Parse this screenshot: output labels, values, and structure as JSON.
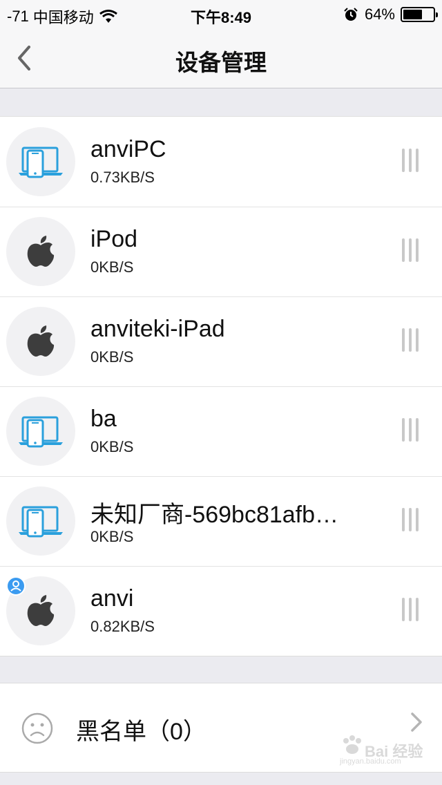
{
  "status_bar": {
    "signal": "-71",
    "carrier": "中国移动",
    "time": "下午8:49",
    "battery_percent_label": "64%",
    "battery_level": 0.64,
    "icons": [
      "wifi-icon",
      "alarm-icon",
      "battery-icon"
    ]
  },
  "nav": {
    "title": "设备管理",
    "back_icon": "chevron-left-icon"
  },
  "devices": [
    {
      "name": "anviPC",
      "speed": "0.73KB/S",
      "icon": "laptop-phone-icon",
      "is_current_user": false
    },
    {
      "name": "iPod",
      "speed": "0KB/S",
      "icon": "apple-icon",
      "is_current_user": false
    },
    {
      "name": "anviteki-iPad",
      "speed": "0KB/S",
      "icon": "apple-icon",
      "is_current_user": false
    },
    {
      "name": "ba",
      "speed": "0KB/S",
      "icon": "laptop-phone-icon",
      "is_current_user": false
    },
    {
      "name": "未知厂商-569bc81afb…",
      "speed": "0KB/S",
      "icon": "laptop-phone-icon",
      "is_current_user": false
    },
    {
      "name": "anvi",
      "speed": "0.82KB/S",
      "icon": "apple-icon",
      "is_current_user": true
    }
  ],
  "blacklist": {
    "label": "黑名单（0）",
    "icon": "sad-face-icon",
    "chevron_icon": "chevron-right-icon"
  },
  "watermark": {
    "text": "Bai 经验",
    "url": "jingyan.baidu.com"
  },
  "colors": {
    "accent_blue": "#2aa0dc",
    "badge_blue": "#3b9bf0",
    "apple_gray": "#3d3d3d",
    "handle_gray": "#c8c8c8"
  }
}
